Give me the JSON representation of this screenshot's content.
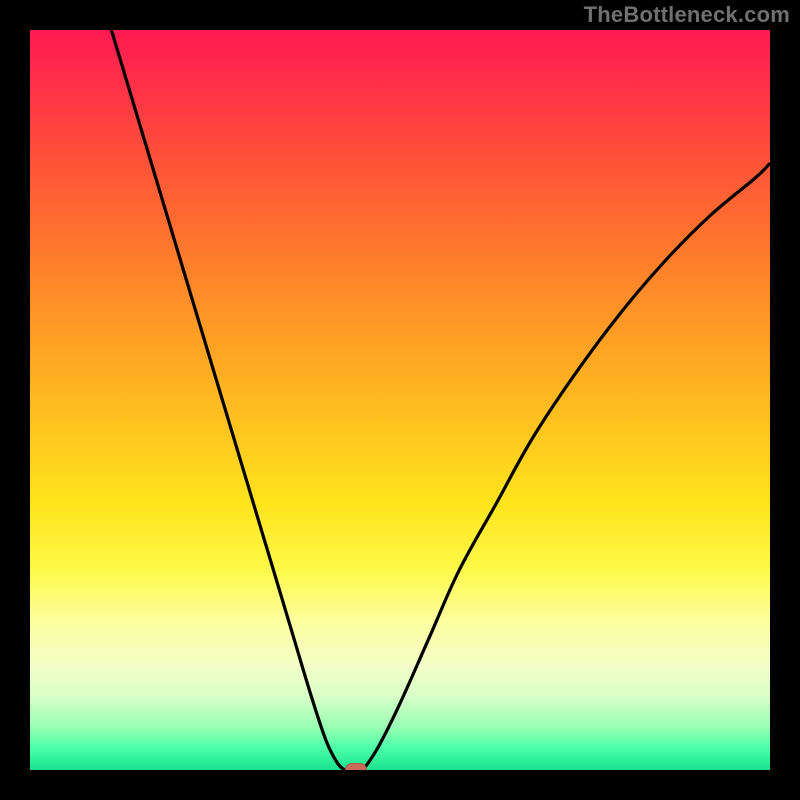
{
  "watermark": "TheBottleneck.com",
  "chart_data": {
    "type": "line",
    "title": "",
    "xlabel": "",
    "ylabel": "",
    "xlim": [
      0,
      100
    ],
    "ylim": [
      0,
      100
    ],
    "grid": false,
    "legend": false,
    "series": [
      {
        "name": "curve-left",
        "x": [
          11,
          14,
          17,
          20,
          23,
          26,
          29,
          32,
          35,
          38,
          40,
          41.5,
          42.5
        ],
        "y": [
          100,
          90,
          80,
          70,
          60,
          50,
          40,
          30,
          20,
          10,
          4,
          1,
          0
        ]
      },
      {
        "name": "curve-right",
        "x": [
          45,
          47,
          50,
          54,
          58,
          63,
          68,
          74,
          80,
          86,
          92,
          98,
          100
        ],
        "y": [
          0,
          3,
          9,
          18,
          27,
          36,
          45,
          54,
          62,
          69,
          75,
          80,
          82
        ]
      }
    ],
    "marker": {
      "x": 44,
      "y": 0,
      "color": "#c96a5a"
    },
    "background_gradient": {
      "top": "#ff1a52",
      "middle": "#ffe41c",
      "bottom": "#18e28e"
    },
    "frame_color": "#000000"
  }
}
